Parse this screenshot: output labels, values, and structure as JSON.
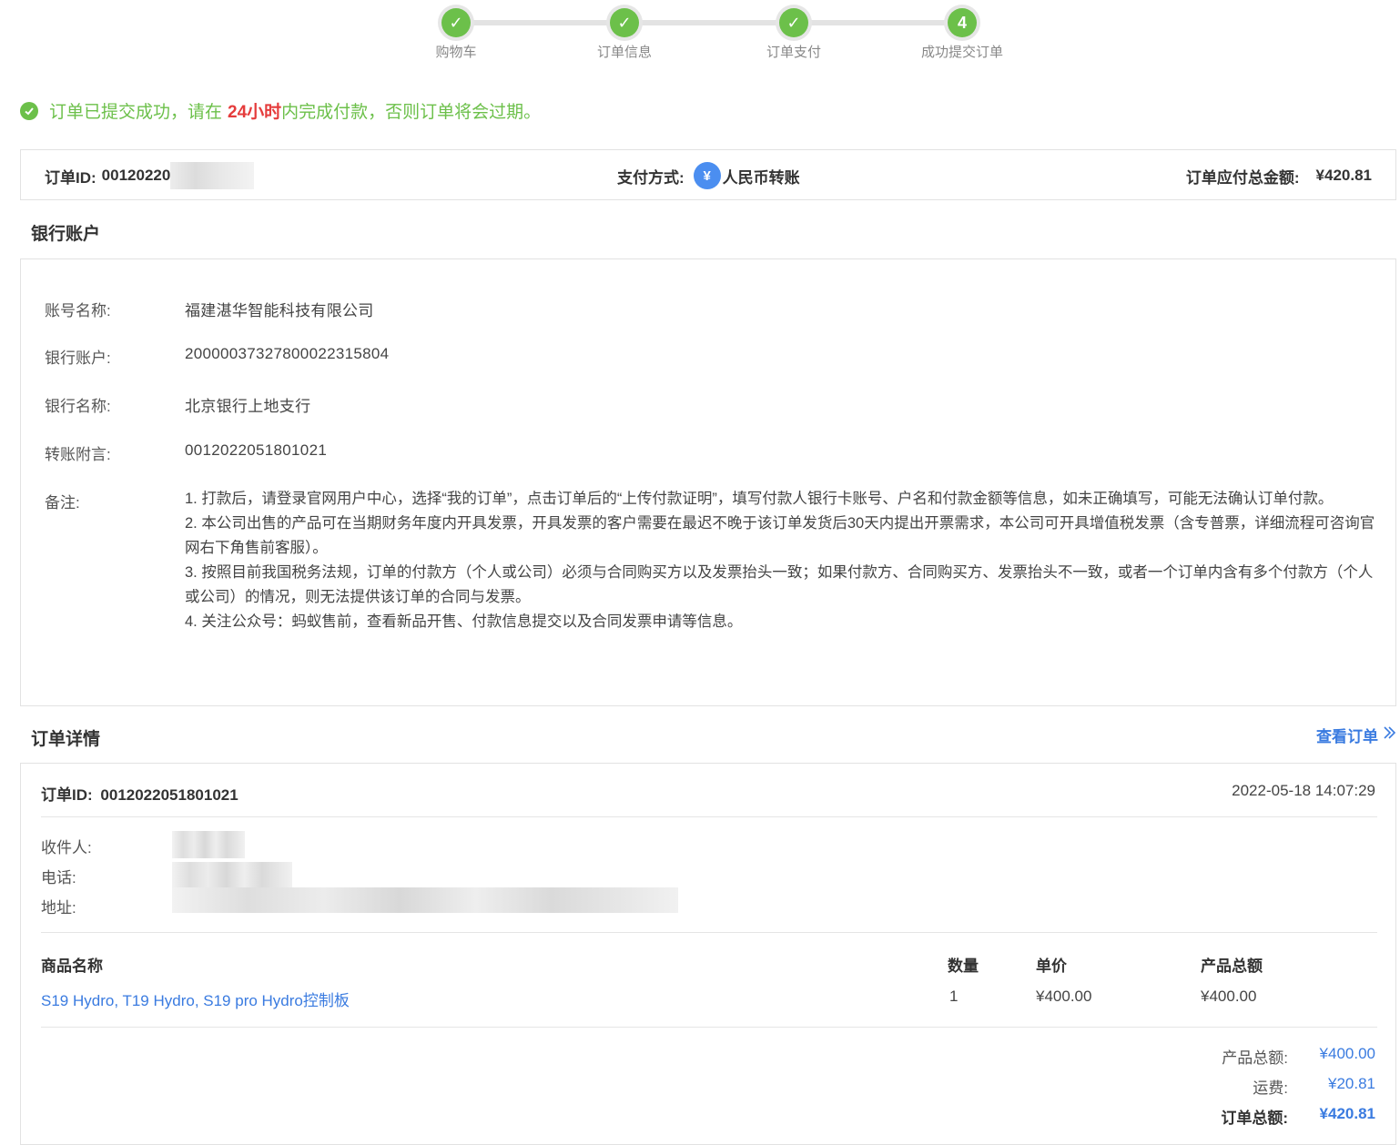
{
  "steps": [
    {
      "label": "购物车",
      "state": "done",
      "badge": "✓"
    },
    {
      "label": "订单信息",
      "state": "done",
      "badge": "✓"
    },
    {
      "label": "订单支付",
      "state": "done",
      "badge": "✓"
    },
    {
      "label": "成功提交订单",
      "state": "current",
      "badge": "4"
    }
  ],
  "notice": {
    "prefix": "订单已提交成功，请在",
    "highlight": "24小时",
    "suffix": "内完成付款，否则订单将会过期。"
  },
  "order_bar": {
    "order_id_label": "订单ID:",
    "order_id_visible": "00120220",
    "payment_label": "支付方式:",
    "payment_icon": "yen-icon",
    "payment_value": "人民币转账",
    "total_label": "订单应付总金额:",
    "total_value": "¥420.81"
  },
  "bank_section": {
    "title": "银行账户",
    "rows": [
      {
        "label": "账号名称:",
        "value": "福建湛华智能科技有限公司"
      },
      {
        "label": "银行账户:",
        "value": "20000037327800022315804"
      },
      {
        "label": "银行名称:",
        "value": "北京银行上地支行"
      },
      {
        "label": "转账附言:",
        "value": "0012022051801021"
      }
    ],
    "notes_label": "备注:",
    "notes": [
      "1. 打款后，请登录官网用户中心，选择“我的订单”，点击订单后的“上传付款证明”，填写付款人银行卡账号、户名和付款金额等信息，如未正确填写，可能无法确认订单付款。",
      "2. 本公司出售的产品可在当期财务年度内开具发票，开具发票的客户需要在最迟不晚于该订单发货后30天内提出开票需求，本公司可开具增值税发票（含专普票，详细流程可咨询官网右下角售前客服）。",
      "3. 按照目前我国税务法规，订单的付款方（个人或公司）必须与合同购买方以及发票抬头一致；如果付款方、合同购买方、发票抬头不一致，或者一个订单内含有多个付款方（个人或公司）的情况，则无法提供该订单的合同与发票。",
      "4. 关注公众号：蚂蚁售前，查看新品开售、付款信息提交以及合同发票申请等信息。"
    ]
  },
  "order_detail": {
    "title": "订单详情",
    "view_link": "查看订单",
    "order_id_label": "订单ID:",
    "order_id": "0012022051801021",
    "datetime": "2022-05-18 14:07:29",
    "recipient_label": "收件人:",
    "phone_label": "电话:",
    "address_label": "地址:",
    "columns": [
      "商品名称",
      "数量",
      "单价",
      "产品总额"
    ],
    "items": [
      {
        "name": "S19 Hydro, T19 Hydro, S19 pro Hydro控制板",
        "qty": "1",
        "unit_price": "¥400.00",
        "total": "¥400.00"
      }
    ],
    "summary": {
      "product_total_label": "产品总额:",
      "product_total": "¥400.00",
      "shipping_label": "运费:",
      "shipping": "¥20.81",
      "order_total_label": "订单总额:",
      "order_total": "¥420.81"
    }
  },
  "colors": {
    "success": "#6cc04a",
    "highlight": "#e53c3c",
    "link": "#3a7be0"
  }
}
